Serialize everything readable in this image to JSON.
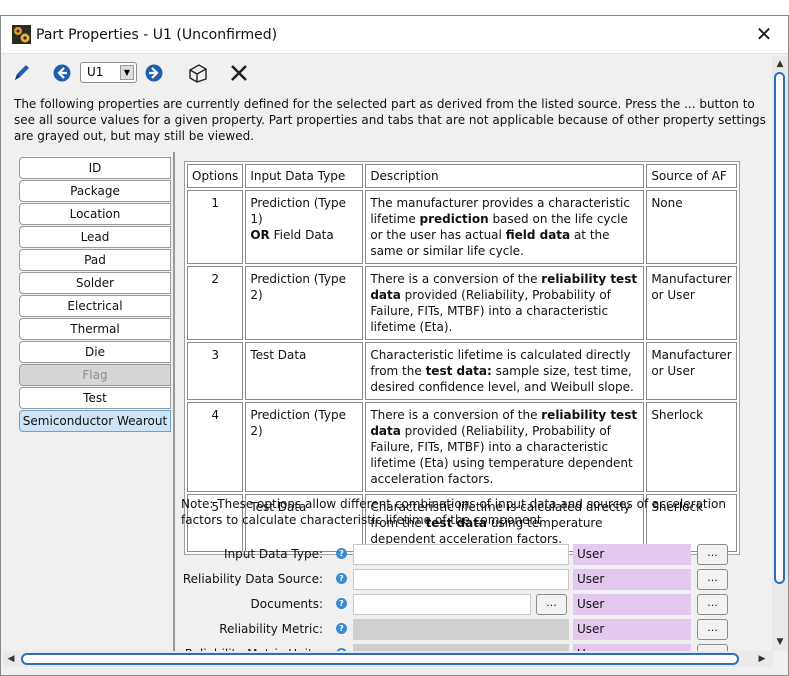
{
  "window": {
    "title": "Part Properties - U1 (Unconfirmed)"
  },
  "toolbar": {
    "part_select": "U1",
    "icons": [
      "pencil-icon",
      "back-arrow-icon",
      "forward-arrow-icon",
      "3d-box-icon",
      "delete-x-icon"
    ]
  },
  "intro": "The following properties are currently defined for the selected part as derived from the listed source. Press the ... button to see all source values for a given property. Part properties and tabs that are not applicable because of other property settings are grayed out, but may still be viewed.",
  "tabs": [
    {
      "label": "ID",
      "state": "normal"
    },
    {
      "label": "Package",
      "state": "normal"
    },
    {
      "label": "Location",
      "state": "normal"
    },
    {
      "label": "Lead",
      "state": "normal"
    },
    {
      "label": "Pad",
      "state": "normal"
    },
    {
      "label": "Solder",
      "state": "normal"
    },
    {
      "label": "Electrical",
      "state": "normal"
    },
    {
      "label": "Thermal",
      "state": "normal"
    },
    {
      "label": "Die",
      "state": "normal"
    },
    {
      "label": "Flag",
      "state": "disabled"
    },
    {
      "label": "Test",
      "state": "normal"
    },
    {
      "label": "Semiconductor Wearout",
      "state": "active"
    }
  ],
  "table": {
    "headers": [
      "Options",
      "Input Data Type",
      "Description",
      "Source of AF"
    ],
    "rows": [
      {
        "option": "1",
        "input_html": "Prediction (Type 1)<br><b>OR</b> Field Data",
        "desc_html": "The manufacturer provides a characteristic lifetime <b>prediction</b> based on the life cycle or the user has actual <b>field data</b> at the same or similar life cycle.",
        "source": "None"
      },
      {
        "option": "2",
        "input_html": "Prediction (Type 2)",
        "desc_html": "There is a conversion of the <b>reliability test data</b> provided (Reliability, Probability of Failure, FITs, MTBF) into a characteristic lifetime (Eta).",
        "source": "Manufacturer or User"
      },
      {
        "option": "3",
        "input_html": "Test Data",
        "desc_html": "Characteristic lifetime is calculated directly from the <b>test data:</b> sample size, test time, desired confidence level, and Weibull slope.",
        "source": "Manufacturer or User"
      },
      {
        "option": "4",
        "input_html": "Prediction (Type 2)",
        "desc_html": "There is a conversion of the <b>reliability test data</b> provided (Reliability, Probability of Failure, FITs, MTBF) into a characteristic lifetime (Eta) using temperature dependent acceleration factors.",
        "source": "Sherlock"
      },
      {
        "option": "5",
        "input_html": "Test Data",
        "desc_html": "Characteristic lifetime is calculated directly from the <b>test data</b> using temperature dependent acceleration factors.",
        "source": "Sherlock"
      }
    ]
  },
  "note": "Note: These options allow different combinations of input data and sources of acceleration factors to calculate characteristic lifetime of the component",
  "fields": [
    {
      "label": "Input Data Type:",
      "value": "",
      "source": "User",
      "kind": "normal"
    },
    {
      "label": "Reliability Data Source:",
      "value": "",
      "source": "User",
      "kind": "normal"
    },
    {
      "label": "Documents:",
      "value": "",
      "source": "User",
      "kind": "short"
    },
    {
      "label": "Reliability Metric:",
      "value": "",
      "source": "User",
      "kind": "gray"
    },
    {
      "label": "Reliability Metric Units:",
      "value": "",
      "source": "User",
      "kind": "gray"
    }
  ],
  "buttons": {
    "ellipsis": "..."
  },
  "colors": {
    "active_tab": "#cde3f7",
    "source_bg": "#e3c9ee",
    "help_icon": "#3a8ccf",
    "scroll_accent": "#2b6fb7"
  }
}
